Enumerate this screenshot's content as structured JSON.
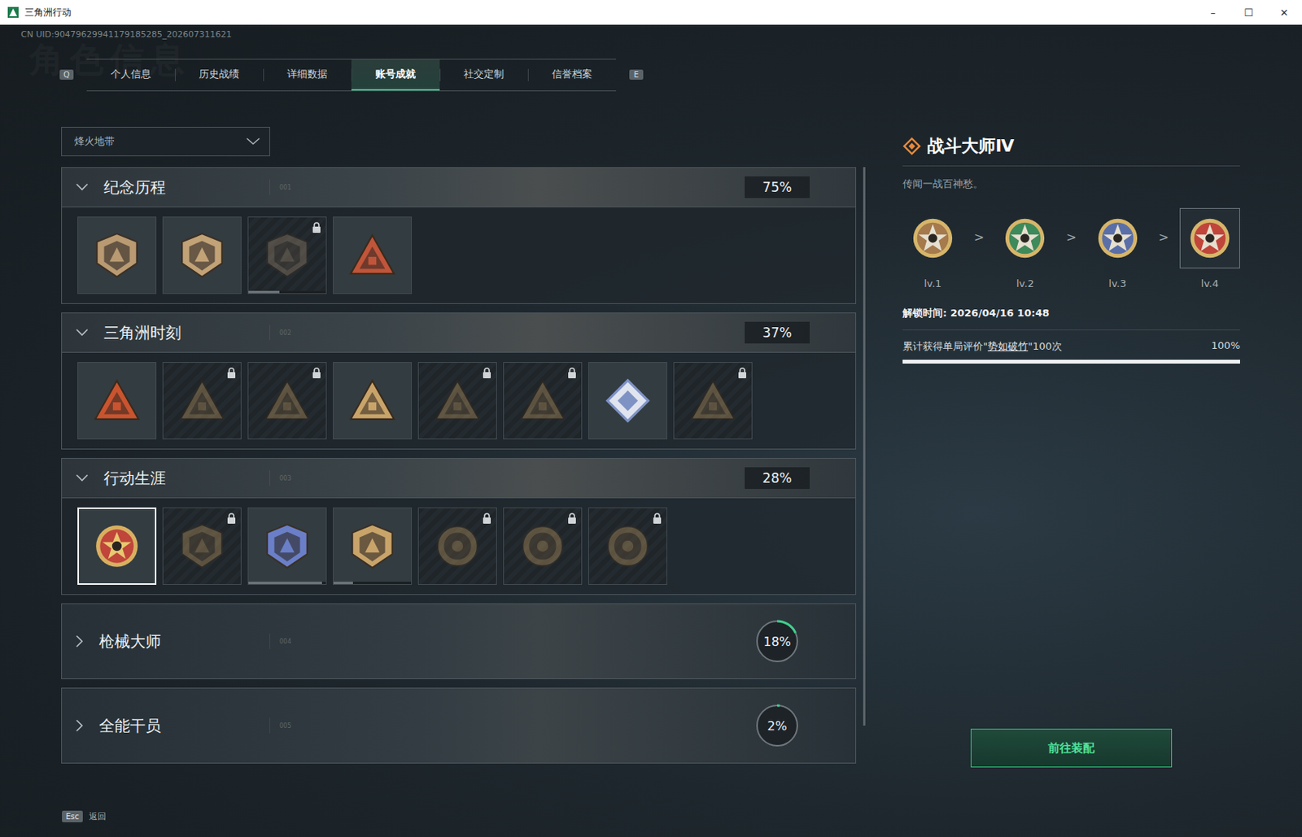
{
  "window": {
    "title": "三角洲行动",
    "controls": [
      "–",
      "☐",
      "✕"
    ]
  },
  "uid": "CN UID:90479629941179185285_202607311621",
  "watermark": "角色信息",
  "tabs": {
    "prev_key": "Q",
    "next_key": "E",
    "items": [
      {
        "label": "个人信息",
        "selected": false
      },
      {
        "label": "历史战绩",
        "selected": false
      },
      {
        "label": "详细数据",
        "selected": false
      },
      {
        "label": "账号成就",
        "selected": true
      },
      {
        "label": "社交定制",
        "selected": false
      },
      {
        "label": "信誉档案",
        "selected": false
      }
    ]
  },
  "mode_select": {
    "value": "烽火地带"
  },
  "sections": [
    {
      "title": "纪念历程",
      "code": "001",
      "percent": "75%",
      "expanded": true,
      "badges": [
        {
          "kind": "shield",
          "color": "#b99a72",
          "locked": false,
          "selected": false
        },
        {
          "kind": "shield",
          "color": "#c2a277",
          "locked": false,
          "selected": false
        },
        {
          "kind": "shield",
          "color": "#8a7a66",
          "locked": true,
          "selected": false,
          "level": 0.4
        },
        {
          "kind": "triangle",
          "color": "#c0553a",
          "locked": false,
          "selected": false
        }
      ]
    },
    {
      "title": "三角洲时刻",
      "code": "002",
      "percent": "37%",
      "expanded": true,
      "badges": [
        {
          "kind": "triangle",
          "color": "#c9542f",
          "locked": false,
          "selected": false
        },
        {
          "kind": "triangle",
          "color": "#a88a5a",
          "locked": true,
          "selected": false
        },
        {
          "kind": "triangle",
          "color": "#a88a5a",
          "locked": true,
          "selected": false
        },
        {
          "kind": "triangle",
          "color": "#c9a46a",
          "locked": false,
          "selected": false
        },
        {
          "kind": "triangle",
          "color": "#a88a5a",
          "locked": true,
          "selected": false
        },
        {
          "kind": "triangle",
          "color": "#a88a5a",
          "locked": true,
          "selected": false
        },
        {
          "kind": "diamond",
          "color": "#7f92c4",
          "locked": false,
          "selected": false
        },
        {
          "kind": "triangle",
          "color": "#a88a5a",
          "locked": true,
          "selected": false
        }
      ]
    },
    {
      "title": "行动生涯",
      "code": "003",
      "percent": "28%",
      "expanded": true,
      "badges": [
        {
          "kind": "medal",
          "color": "#c0453a",
          "locked": false,
          "selected": true
        },
        {
          "kind": "shield",
          "color": "#a88a5a",
          "locked": true,
          "selected": false
        },
        {
          "kind": "shield",
          "color": "#6a7fc8",
          "locked": false,
          "selected": false,
          "level": 0.95
        },
        {
          "kind": "shield",
          "color": "#c9a46a",
          "locked": false,
          "selected": false,
          "level": 0.25
        },
        {
          "kind": "round",
          "color": "#a88a5a",
          "locked": true,
          "selected": false
        },
        {
          "kind": "round",
          "color": "#a88a5a",
          "locked": true,
          "selected": false
        },
        {
          "kind": "round",
          "color": "#a88a5a",
          "locked": true,
          "selected": false
        }
      ]
    },
    {
      "title": "枪械大师",
      "code": "004",
      "percent": "18%",
      "expanded": false,
      "level": 0.18,
      "badges": []
    },
    {
      "title": "全能干员",
      "code": "005",
      "percent": "2%",
      "expanded": false,
      "level": 0.02,
      "badges": []
    }
  ],
  "detail": {
    "title": "战斗大师Ⅳ",
    "quote": "传闻一战百神愁。",
    "separator": ">",
    "levels": [
      {
        "label": "lv.1",
        "color": "#a57a4c",
        "selected": false
      },
      {
        "label": "lv.2",
        "color": "#3f8a5a",
        "selected": false
      },
      {
        "label": "lv.3",
        "color": "#5a6fa8",
        "selected": false
      },
      {
        "label": "lv.4",
        "color": "#c0453a",
        "selected": true
      }
    ],
    "unlock": "解锁时间: 2026/04/16 10:48",
    "task_prefix": "累计获得单局评价\"",
    "task_highlight": "势如破竹",
    "task_suffix": "\"100次",
    "task_percent": "100%",
    "task_level": 1,
    "button": "前往装配"
  },
  "footer": {
    "key": "Esc",
    "label": "返回"
  }
}
